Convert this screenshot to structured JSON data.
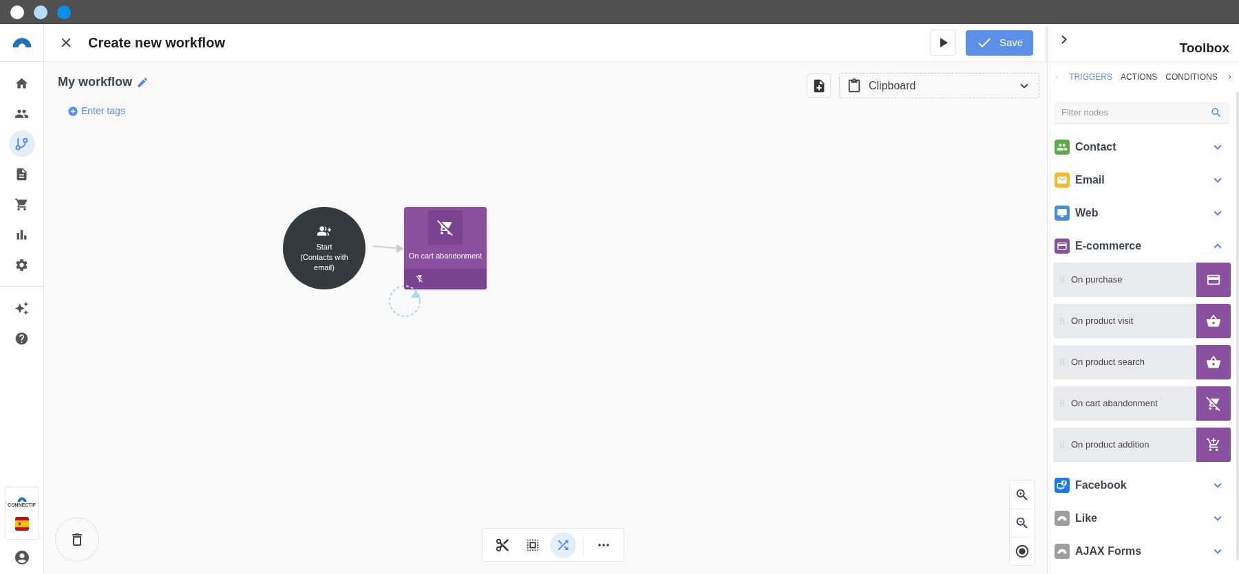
{
  "window": {
    "title": "Create new workflow"
  },
  "header": {
    "save": "Save"
  },
  "sidebar": {
    "items": [
      {
        "kind": "home",
        "selected": false
      },
      {
        "kind": "contacts",
        "selected": false
      },
      {
        "kind": "workflows",
        "selected": true
      },
      {
        "kind": "documents",
        "selected": false
      },
      {
        "kind": "shop",
        "selected": false
      },
      {
        "kind": "reports",
        "selected": false
      },
      {
        "kind": "settings",
        "selected": false
      },
      {
        "kind": "ai",
        "selected": false
      },
      {
        "kind": "help",
        "selected": false
      }
    ],
    "brand": "CONNECTIF"
  },
  "workflow": {
    "name": "My workflow",
    "tags_link": "Enter tags"
  },
  "clipboard": {
    "label": "Clipboard"
  },
  "nodes": [
    {
      "kind": "start",
      "label": "Start",
      "sublabel": "(Contacts with email)"
    },
    {
      "kind": "cart-abandonment",
      "label": "On cart abandonment"
    }
  ],
  "canvas_tools": [
    {
      "kind": "cut",
      "selected": false
    },
    {
      "kind": "select",
      "selected": false
    },
    {
      "kind": "auto-layout",
      "selected": true
    },
    {
      "kind": "more",
      "selected": false
    }
  ],
  "toolbox": {
    "title": "Toolbox",
    "tabs": [
      {
        "label": "TRIGGERS",
        "selected": true
      },
      {
        "label": "ACTIONS",
        "selected": false
      },
      {
        "label": "CONDITIONS",
        "selected": false
      }
    ],
    "filter": {
      "placeholder": "Filter nodes"
    },
    "categories": [
      {
        "name": "Contact",
        "kind": "contact",
        "color": "#5cad4a",
        "expanded": false
      },
      {
        "name": "Email",
        "kind": "email",
        "color": "#f6b92b",
        "expanded": false
      },
      {
        "name": "Web",
        "kind": "web",
        "color": "#4a90d9",
        "expanded": false
      },
      {
        "name": "E-commerce",
        "kind": "card",
        "color": "#8a4f9e",
        "expanded": true,
        "items": [
          {
            "label": "On purchase",
            "kind": "card"
          },
          {
            "label": "On product visit",
            "kind": "basket"
          },
          {
            "label": "On product search",
            "kind": "basket"
          },
          {
            "label": "On cart abandonment",
            "kind": "cart-off"
          },
          {
            "label": "On product addition",
            "kind": "cart-add"
          }
        ]
      },
      {
        "name": "Facebook",
        "kind": "facebook",
        "color": "#1877f2",
        "expanded": false
      },
      {
        "name": "Like",
        "kind": "arc",
        "color": "#9e9e9e",
        "expanded": false
      },
      {
        "name": "AJAX Forms",
        "kind": "arc",
        "color": "#9e9e9e",
        "expanded": false
      }
    ]
  }
}
